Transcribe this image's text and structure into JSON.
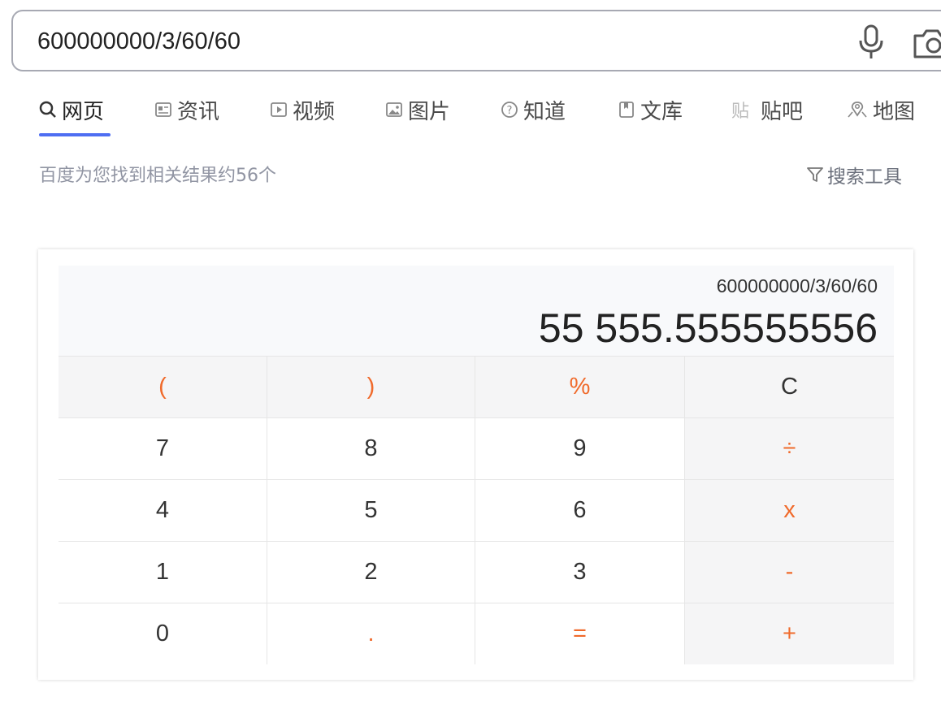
{
  "search": {
    "query": "600000000/3/60/60",
    "mic_icon": "microphone-icon",
    "camera_icon": "camera-icon"
  },
  "tabs": [
    {
      "label": "网页",
      "icon": "search-icon",
      "active": true
    },
    {
      "label": "资讯",
      "icon": "news-icon"
    },
    {
      "label": "视频",
      "icon": "video-icon"
    },
    {
      "label": "图片",
      "icon": "image-icon"
    },
    {
      "label": "知道",
      "icon": "question-icon"
    },
    {
      "label": "文库",
      "icon": "document-icon"
    },
    {
      "label": "贴吧",
      "icon": "tieba-icon"
    },
    {
      "label": "地图",
      "icon": "map-icon"
    }
  ],
  "results": {
    "count_text": "百度为您找到相关结果约56个",
    "tools_label": "搜索工具"
  },
  "calculator": {
    "expression": "600000000/3/60/60",
    "result": "55 555.555555556",
    "keys": [
      [
        "(",
        ")",
        "%",
        "C"
      ],
      [
        "7",
        "8",
        "9",
        "÷"
      ],
      [
        "4",
        "5",
        "6",
        "x"
      ],
      [
        "1",
        "2",
        "3",
        "-"
      ],
      [
        "0",
        ".",
        "=",
        "+"
      ]
    ]
  },
  "colors": {
    "accent": "#4e6ef2",
    "operator": "#f06a2b"
  }
}
